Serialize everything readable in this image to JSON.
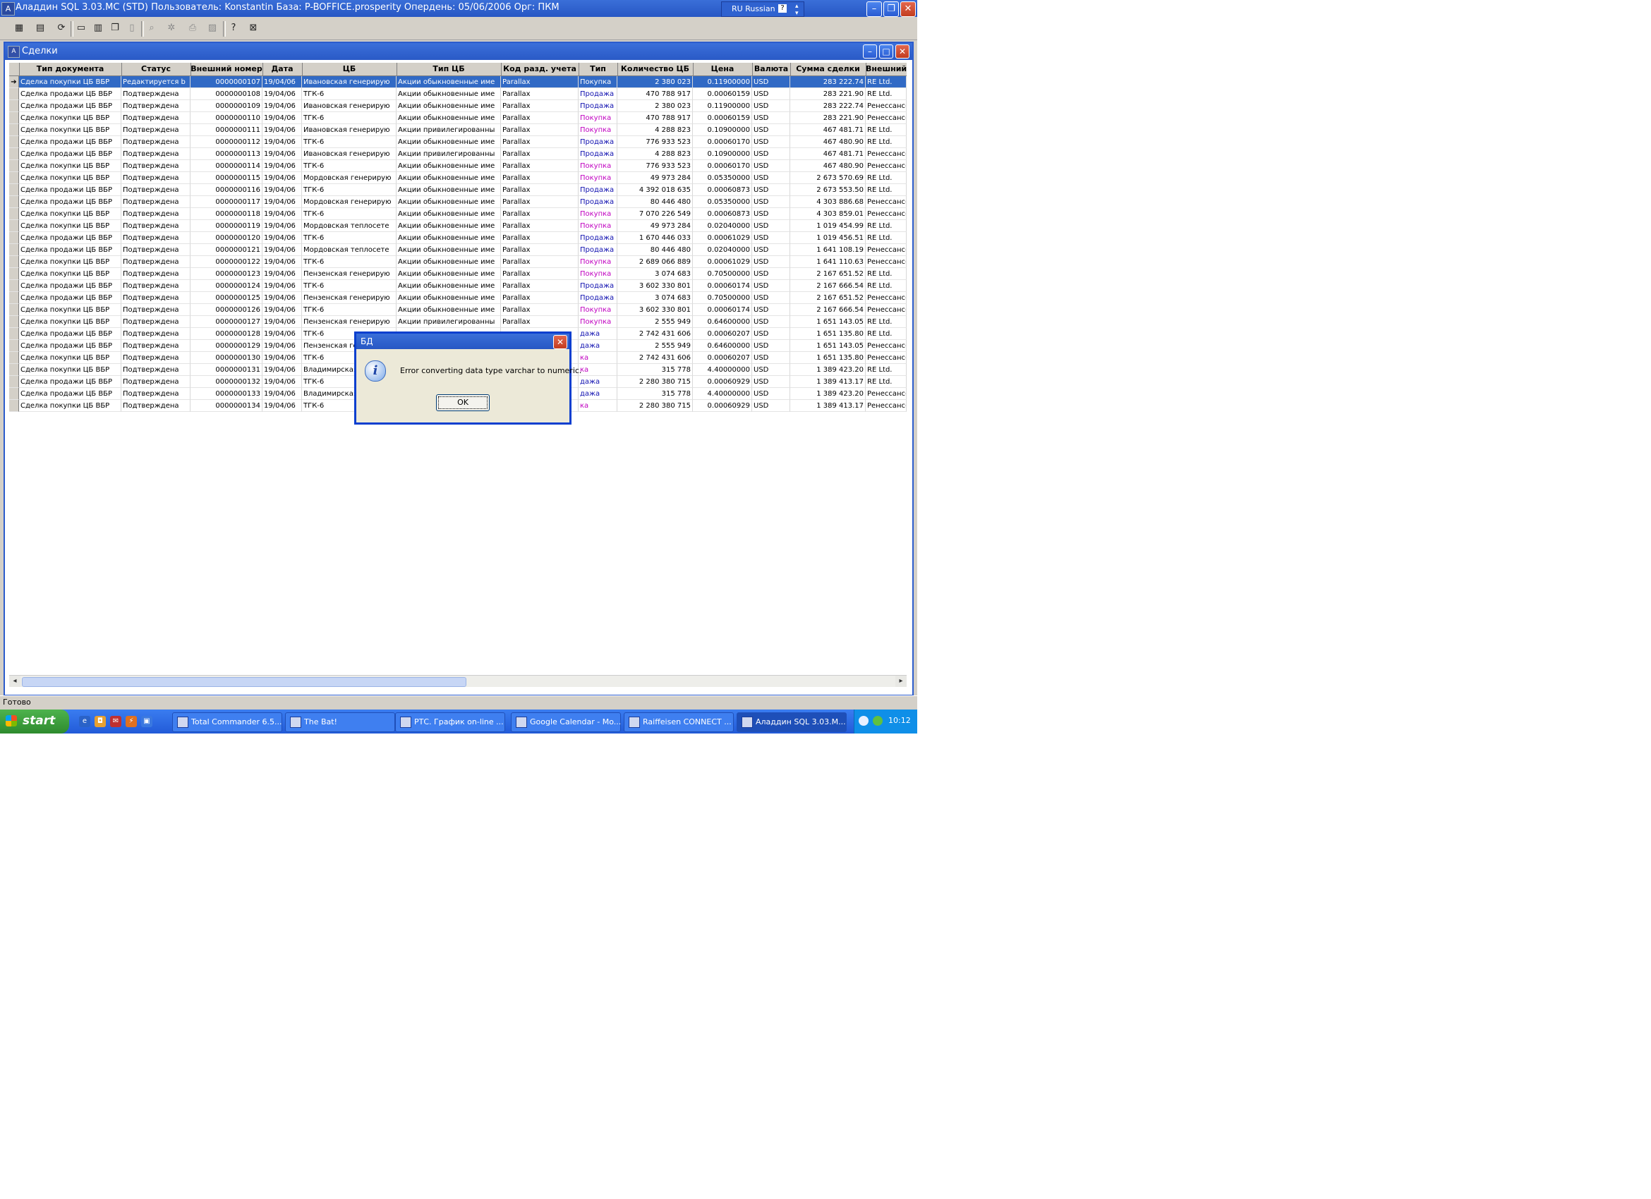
{
  "app": {
    "title": "Аладдин SQL 3.03.MC (STD)  Пользователь: Konstantin База: P-BOFFICE.prosperity Опердень: 05/06/2006 Орг: ПКМ",
    "language": "RU Russian",
    "help_glyph": "?"
  },
  "child_window": {
    "title": "Сделки"
  },
  "grid": {
    "columns": [
      "Тип документа",
      "Статус",
      "Внешний номер",
      "Дата",
      "ЦБ",
      "Тип ЦБ",
      "Код разд. учета",
      "Тип",
      "Количество ЦБ",
      "Цена",
      "Валюта",
      "Сумма сделки",
      "Внешний брокер"
    ],
    "rows": [
      [
        "Сделка покупки ЦБ ВБР",
        "Редактируется b",
        "0000000107",
        "19/04/06",
        "Ивановская генерирую",
        "Акции обыкновенные име",
        "Parallax",
        "Покупка",
        "2 380 023",
        "0.11900000",
        "USD",
        "283 222.74",
        "RE Ltd."
      ],
      [
        "Сделка продажи ЦБ ВБР",
        "Подтверждена",
        "0000000108",
        "19/04/06",
        "ТГК-6",
        "Акции обыкновенные име",
        "Parallax",
        "Продажа",
        "470 788 917",
        "0.00060159",
        "USD",
        "283 221.90",
        "RE Ltd."
      ],
      [
        "Сделка продажи ЦБ ВБР",
        "Подтверждена",
        "0000000109",
        "19/04/06",
        "Ивановская генерирую",
        "Акции обыкновенные име",
        "Parallax",
        "Продажа",
        "2 380 023",
        "0.11900000",
        "USD",
        "283 222.74",
        "Ренессанс-Брокер"
      ],
      [
        "Сделка покупки ЦБ ВБР",
        "Подтверждена",
        "0000000110",
        "19/04/06",
        "ТГК-6",
        "Акции обыкновенные име",
        "Parallax",
        "Покупка",
        "470 788 917",
        "0.00060159",
        "USD",
        "283 221.90",
        "Ренессанс-Брокер"
      ],
      [
        "Сделка покупки ЦБ ВБР",
        "Подтверждена",
        "0000000111",
        "19/04/06",
        "Ивановская генерирую",
        "Акции привилегированны",
        "Parallax",
        "Покупка",
        "4 288 823",
        "0.10900000",
        "USD",
        "467 481.71",
        "RE Ltd."
      ],
      [
        "Сделка продажи ЦБ ВБР",
        "Подтверждена",
        "0000000112",
        "19/04/06",
        "ТГК-6",
        "Акции обыкновенные име",
        "Parallax",
        "Продажа",
        "776 933 523",
        "0.00060170",
        "USD",
        "467 480.90",
        "RE Ltd."
      ],
      [
        "Сделка продажи ЦБ ВБР",
        "Подтверждена",
        "0000000113",
        "19/04/06",
        "Ивановская генерирую",
        "Акции привилегированны",
        "Parallax",
        "Продажа",
        "4 288 823",
        "0.10900000",
        "USD",
        "467 481.71",
        "Ренессанс-Брокер"
      ],
      [
        "Сделка покупки ЦБ ВБР",
        "Подтверждена",
        "0000000114",
        "19/04/06",
        "ТГК-6",
        "Акции обыкновенные име",
        "Parallax",
        "Покупка",
        "776 933 523",
        "0.00060170",
        "USD",
        "467 480.90",
        "Ренессанс-Брокер"
      ],
      [
        "Сделка покупки ЦБ ВБР",
        "Подтверждена",
        "0000000115",
        "19/04/06",
        "Мордовская генерирую",
        "Акции обыкновенные име",
        "Parallax",
        "Покупка",
        "49 973 284",
        "0.05350000",
        "USD",
        "2 673 570.69",
        "RE Ltd."
      ],
      [
        "Сделка продажи ЦБ ВБР",
        "Подтверждена",
        "0000000116",
        "19/04/06",
        "ТГК-6",
        "Акции обыкновенные име",
        "Parallax",
        "Продажа",
        "4 392 018 635",
        "0.00060873",
        "USD",
        "2 673 553.50",
        "RE Ltd."
      ],
      [
        "Сделка продажи ЦБ ВБР",
        "Подтверждена",
        "0000000117",
        "19/04/06",
        "Мордовская генерирую",
        "Акции обыкновенные име",
        "Parallax",
        "Продажа",
        "80 446 480",
        "0.05350000",
        "USD",
        "4 303 886.68",
        "Ренессанс-Брокер"
      ],
      [
        "Сделка покупки ЦБ ВБР",
        "Подтверждена",
        "0000000118",
        "19/04/06",
        "ТГК-6",
        "Акции обыкновенные име",
        "Parallax",
        "Покупка",
        "7 070 226 549",
        "0.00060873",
        "USD",
        "4 303 859.01",
        "Ренессанс-Брокер"
      ],
      [
        "Сделка покупки ЦБ ВБР",
        "Подтверждена",
        "0000000119",
        "19/04/06",
        "Мордовская теплосете",
        "Акции обыкновенные име",
        "Parallax",
        "Покупка",
        "49 973 284",
        "0.02040000",
        "USD",
        "1 019 454.99",
        "RE Ltd."
      ],
      [
        "Сделка продажи ЦБ ВБР",
        "Подтверждена",
        "0000000120",
        "19/04/06",
        "ТГК-6",
        "Акции обыкновенные име",
        "Parallax",
        "Продажа",
        "1 670 446 033",
        "0.00061029",
        "USD",
        "1 019 456.51",
        "RE Ltd."
      ],
      [
        "Сделка продажи ЦБ ВБР",
        "Подтверждена",
        "0000000121",
        "19/04/06",
        "Мордовская теплосете",
        "Акции обыкновенные име",
        "Parallax",
        "Продажа",
        "80 446 480",
        "0.02040000",
        "USD",
        "1 641 108.19",
        "Ренессанс-Брокер"
      ],
      [
        "Сделка покупки ЦБ ВБР",
        "Подтверждена",
        "0000000122",
        "19/04/06",
        "ТГК-6",
        "Акции обыкновенные име",
        "Parallax",
        "Покупка",
        "2 689 066 889",
        "0.00061029",
        "USD",
        "1 641 110.63",
        "Ренессанс-Брокер"
      ],
      [
        "Сделка покупки ЦБ ВБР",
        "Подтверждена",
        "0000000123",
        "19/04/06",
        "Пензенская генерирую",
        "Акции обыкновенные име",
        "Parallax",
        "Покупка",
        "3 074 683",
        "0.70500000",
        "USD",
        "2 167 651.52",
        "RE Ltd."
      ],
      [
        "Сделка продажи ЦБ ВБР",
        "Подтверждена",
        "0000000124",
        "19/04/06",
        "ТГК-6",
        "Акции обыкновенные име",
        "Parallax",
        "Продажа",
        "3 602 330 801",
        "0.00060174",
        "USD",
        "2 167 666.54",
        "RE Ltd."
      ],
      [
        "Сделка продажи ЦБ ВБР",
        "Подтверждена",
        "0000000125",
        "19/04/06",
        "Пензенская генерирую",
        "Акции обыкновенные име",
        "Parallax",
        "Продажа",
        "3 074 683",
        "0.70500000",
        "USD",
        "2 167 651.52",
        "Ренессанс-Брокер"
      ],
      [
        "Сделка покупки ЦБ ВБР",
        "Подтверждена",
        "0000000126",
        "19/04/06",
        "ТГК-6",
        "Акции обыкновенные име",
        "Parallax",
        "Покупка",
        "3 602 330 801",
        "0.00060174",
        "USD",
        "2 167 666.54",
        "Ренессанс-Брокер"
      ],
      [
        "Сделка покупки ЦБ ВБР",
        "Подтверждена",
        "0000000127",
        "19/04/06",
        "Пензенская генерирую",
        "Акции привилегированны",
        "Parallax",
        "Покупка",
        "2 555 949",
        "0.64600000",
        "USD",
        "1 651 143.05",
        "RE Ltd."
      ],
      [
        "Сделка продажи ЦБ ВБР",
        "Подтверждена",
        "0000000128",
        "19/04/06",
        "ТГК-6",
        "",
        "",
        "дажа",
        "2 742 431 606",
        "0.00060207",
        "USD",
        "1 651 135.80",
        "RE Ltd."
      ],
      [
        "Сделка продажи ЦБ ВБР",
        "Подтверждена",
        "0000000129",
        "19/04/06",
        "Пензенская ге",
        "",
        "",
        "дажа",
        "2 555 949",
        "0.64600000",
        "USD",
        "1 651 143.05",
        "Ренессанс-Брокер"
      ],
      [
        "Сделка покупки ЦБ ВБР",
        "Подтверждена",
        "0000000130",
        "19/04/06",
        "ТГК-6",
        "",
        "",
        "ка",
        "2 742 431 606",
        "0.00060207",
        "USD",
        "1 651 135.80",
        "Ренессанс-Брокер"
      ],
      [
        "Сделка покупки ЦБ ВБР",
        "Подтверждена",
        "0000000131",
        "19/04/06",
        "Владимирская",
        "",
        "",
        "ка",
        "315 778",
        "4.40000000",
        "USD",
        "1 389 423.20",
        "RE Ltd."
      ],
      [
        "Сделка продажи ЦБ ВБР",
        "Подтверждена",
        "0000000132",
        "19/04/06",
        "ТГК-6",
        "",
        "",
        "дажа",
        "2 280 380 715",
        "0.00060929",
        "USD",
        "1 389 413.17",
        "RE Ltd."
      ],
      [
        "Сделка продажи ЦБ ВБР",
        "Подтверждена",
        "0000000133",
        "19/04/06",
        "Владимирская",
        "",
        "",
        "дажа",
        "315 778",
        "4.40000000",
        "USD",
        "1 389 423.20",
        "Ренессанс-Брокер"
      ],
      [
        "Сделка покупки ЦБ ВБР",
        "Подтверждена",
        "0000000134",
        "19/04/06",
        "ТГК-6",
        "",
        "",
        "ка",
        "2 280 380 715",
        "0.00060929",
        "USD",
        "1 389 413.17",
        "Ренессанс-Брокер"
      ]
    ]
  },
  "dialog": {
    "title": "БД",
    "message": "Error converting data type varchar to numeric.",
    "ok_label": "OK",
    "icon": "info-icon"
  },
  "status": {
    "text": "Готово"
  },
  "taskbar": {
    "start_label": "start",
    "tasks": [
      {
        "label": "Total Commander 6.5..."
      },
      {
        "label": "The Bat!"
      },
      {
        "label": "РТС. График on-line ..."
      },
      {
        "label": "Google Calendar - Mo..."
      },
      {
        "label": "Raiffeisen CONNECT ..."
      },
      {
        "label": "Аладдин SQL 3.03.M..."
      }
    ],
    "clock": "10:12"
  },
  "colors": {
    "title_blue": "#2757c4",
    "selection": "#316ac5",
    "buy_text": "#c000c0",
    "sell_text": "#1010b0",
    "taskbar": "#225bd8",
    "start_green": "#2e8b2e"
  }
}
